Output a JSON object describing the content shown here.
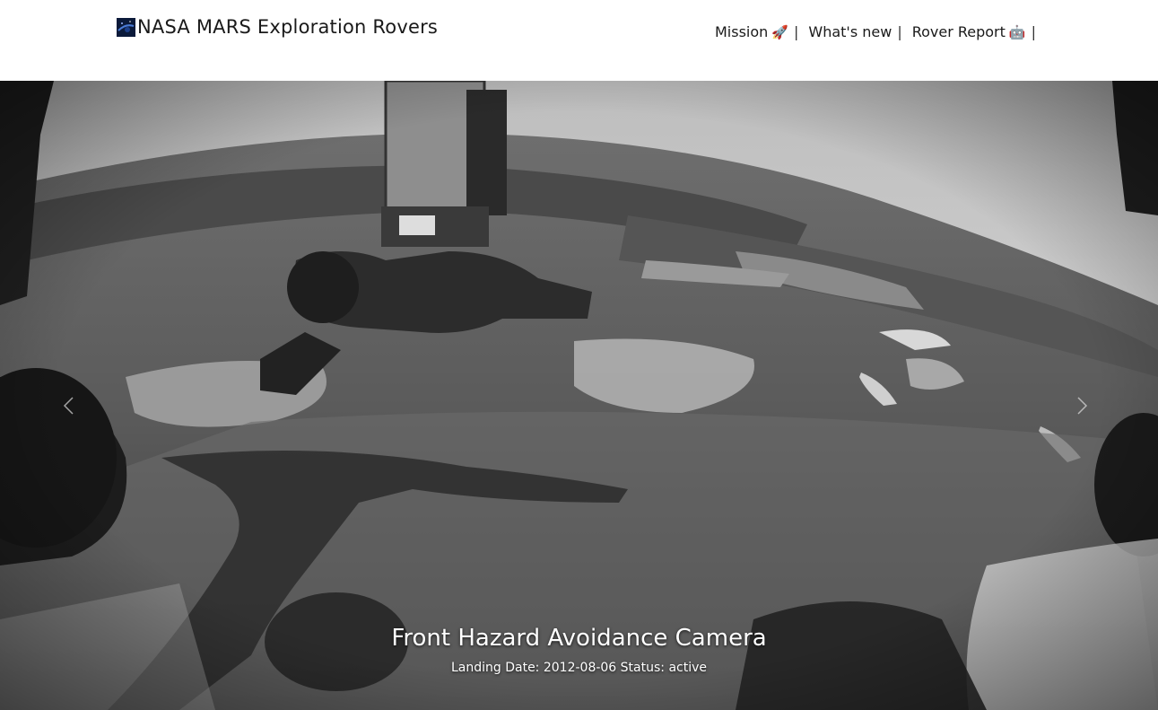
{
  "header": {
    "brand": {
      "icon": "nasa-logo-icon",
      "title": "NASA MARS Exploration Rovers"
    },
    "nav": [
      {
        "label": "Mission",
        "emoji": "🚀",
        "separator": "|"
      },
      {
        "label": "What's new",
        "emoji": "",
        "separator": "|"
      },
      {
        "label": "Rover Report",
        "emoji": "🤖",
        "separator": "|"
      }
    ]
  },
  "carousel": {
    "image_alt": "Mars surface photo from rover front hazard camera",
    "prev_icon": "chevron-left-icon",
    "next_icon": "chevron-right-icon",
    "caption": {
      "title": "Front Hazard Avoidance Camera",
      "meta": "Landing Date: 2012-08-06 Status: active"
    }
  }
}
